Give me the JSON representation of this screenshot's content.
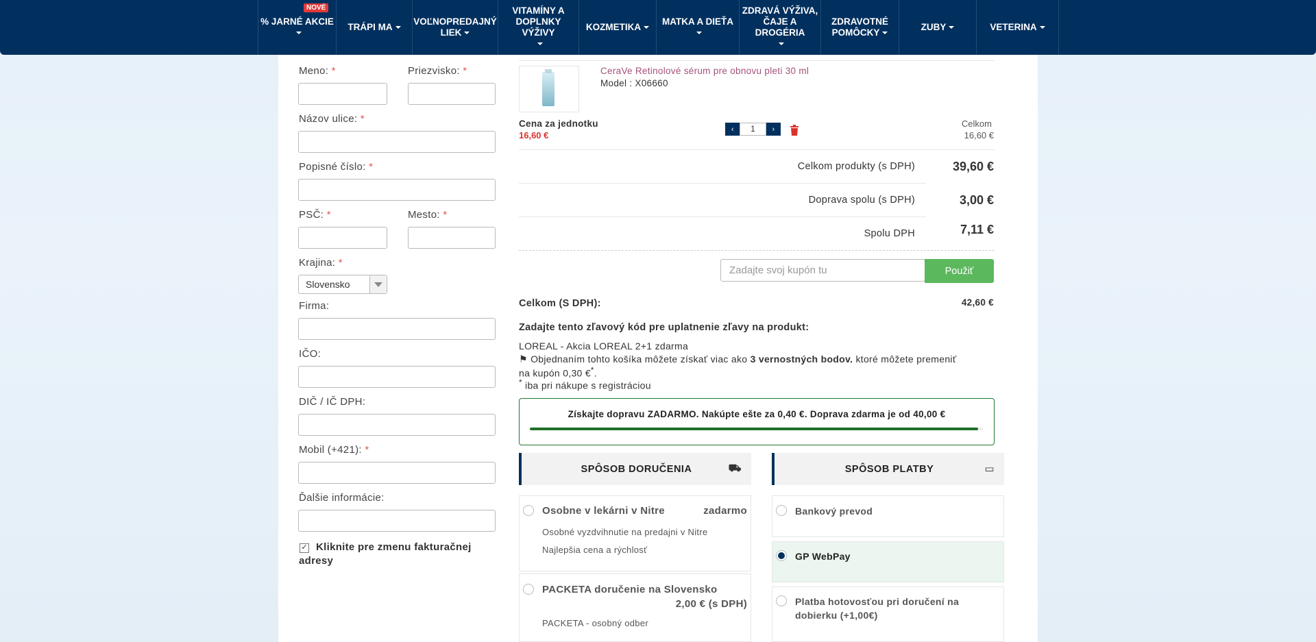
{
  "nav": {
    "new_badge": "NOVÉ",
    "items": [
      {
        "label": "% JARNÉ AKCIE"
      },
      {
        "label": "TRÁPI MA"
      },
      {
        "label_line1": "VOĽNOPREDAJNÝ",
        "label_line2": "LIEK"
      },
      {
        "label_line1": "VITAMÍNY A",
        "label_line2": "DOPLNKY VÝŽIVY"
      },
      {
        "label": "KOZMETIKA"
      },
      {
        "label": "MATKA A DIEŤA"
      },
      {
        "label_line1": "ZDRAVÁ VÝŽIVA,",
        "label_line2": "ČAJE A DROGÉRIA"
      },
      {
        "label_line1": "ZDRAVOTNÉ",
        "label_line2": "POMÔCKY"
      },
      {
        "label": "ZUBY"
      },
      {
        "label": "VETERINA"
      }
    ]
  },
  "form": {
    "required_mark": "*",
    "first_name": "Meno:",
    "last_name": "Priezvisko:",
    "street": "Názov ulice:",
    "house_number": "Popisné číslo:",
    "zip": "PSČ:",
    "city": "Mesto:",
    "country": "Krajina:",
    "country_value": "Slovensko",
    "company": "Firma:",
    "ico": "IČO:",
    "dic": "DIČ / IČ DPH:",
    "mobile": "Mobil (+421):",
    "additional": "Ďalšie informácie:",
    "billing_checkbox": "Kliknite pre zmenu fakturačnej adresy",
    "billing_checked": true
  },
  "cart": {
    "product": {
      "name": "CeraVe Retinolové sérum pre obnovu pleti 30 ml",
      "model": "Model : X06660",
      "unit_price_label": "Cena za jednotku",
      "unit_price": "16,60 €",
      "qty": "1",
      "total_label": "Celkom",
      "total": "16,60 €"
    },
    "summary": {
      "products_label": "Celkom produkty (s DPH)",
      "products_value": "39,60 €",
      "shipping_label": "Doprava spolu (s DPH)",
      "shipping_value": "3,00 €",
      "vat_label": "Spolu DPH",
      "vat_value": "7,11 €"
    },
    "coupon": {
      "placeholder": "Zadajte svoj kupón tu",
      "button": "Použiť"
    },
    "grand_total_label": "Celkom (S DPH):",
    "grand_total": "42,60 €",
    "discount_heading": "Zadajte tento zľavový kód pre uplatnenie zľavy na produkt:",
    "discount_code": "LOREAL - Akcia LOREAL 2+1 zdarma",
    "loyalty_pre": "Objednaním tohto košíka môžete získať viac ako",
    "loyalty_points": "3 vernostných bodov.",
    "loyalty_post": "ktoré môžete premeniť",
    "loyalty_line2": "na kupón 0,30 €",
    "loyalty_note": "iba pri nákupe s registráciou",
    "free_shipping": "Získajte dopravu ZADARMO. Nakúpte ešte za 0,40 €. Doprava zdarma je od 40,00 €",
    "free_shipping_progress": 0.99
  },
  "delivery": {
    "title": "SPÔSOB DORUČENIA",
    "options": [
      {
        "title": "Osobne v lekárni v Nitre",
        "price": "zadarmo",
        "sub1": "Osobné vyzdvihnutie na predajni v Nitre",
        "sub2": "Najlepšia cena a rýchlosť"
      },
      {
        "title": "PACKETA doručenie na Slovensko",
        "price": "2,00 € (s DPH)",
        "sub1": "PACKETA - osobný odber"
      }
    ]
  },
  "payment": {
    "title": "SPÔSOB PLATBY",
    "options": [
      {
        "title": "Bankový prevod",
        "selected": false
      },
      {
        "title": "GP WebPay",
        "selected": true
      },
      {
        "title_line1": "Platba hotovosťou pri doručení na",
        "title_line2": "dobierku (+1,00€)",
        "selected": false
      }
    ]
  },
  "colors": {
    "nav_bg": "#02305e",
    "accent_red": "#d9332c",
    "button_green": "#5cb85c",
    "progress_green": "#1e6f26"
  }
}
